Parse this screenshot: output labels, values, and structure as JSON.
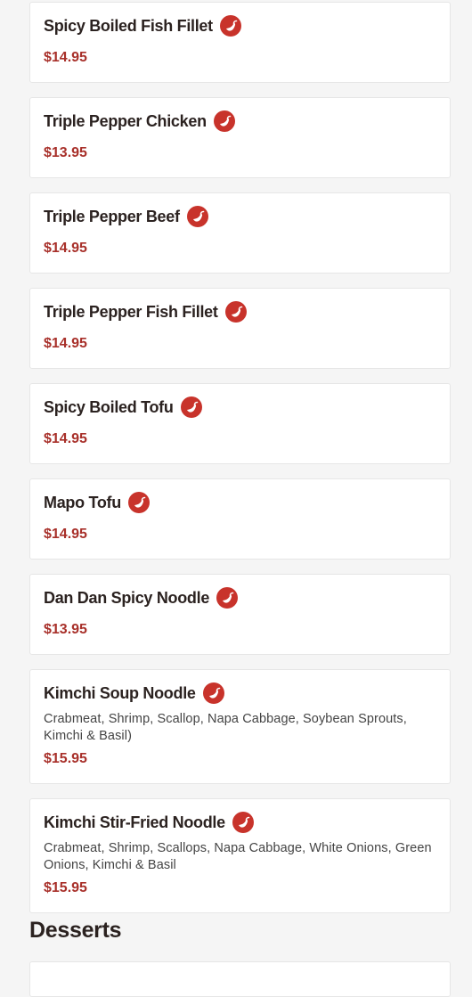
{
  "menu_items": [
    {
      "name": "Spicy Boiled Fish Fillet",
      "price": "$14.95",
      "spicy_icon": "chili-pepper-icon"
    },
    {
      "name": "Triple Pepper Chicken",
      "price": "$13.95",
      "spicy_icon": "chili-pepper-icon"
    },
    {
      "name": "Triple Pepper Beef",
      "price": "$14.95",
      "spicy_icon": "chili-pepper-icon"
    },
    {
      "name": "Triple Pepper Fish Fillet",
      "price": "$14.95",
      "spicy_icon": "chili-pepper-icon"
    },
    {
      "name": "Spicy Boiled Tofu",
      "price": "$14.95",
      "spicy_icon": "chili-pepper-icon"
    },
    {
      "name": "Mapo Tofu",
      "price": "$14.95",
      "spicy_icon": "chili-pepper-icon"
    },
    {
      "name": "Dan Dan Spicy Noodle",
      "price": "$13.95",
      "spicy_icon": "chili-pepper-icon"
    },
    {
      "name": "Kimchi Soup Noodle",
      "description": "Crabmeat, Shrimp, Scallop, Napa Cabbage, Soybean Sprouts, Kimchi & Basil)",
      "price": "$15.95",
      "spicy_icon": "chili-pepper-icon"
    },
    {
      "name": "Kimchi Stir-Fried Noodle",
      "description": "Crabmeat, Shrimp, Scallops, Napa Cabbage, White Onions, Green Onions, Kimchi & Basil",
      "price": "$15.95",
      "spicy_icon": "chili-pepper-icon"
    }
  ],
  "next_section": {
    "title": "Desserts"
  },
  "colors": {
    "accent": "#a8302a",
    "spicy_badge": "#c8332b",
    "background": "#f5f5f5"
  }
}
